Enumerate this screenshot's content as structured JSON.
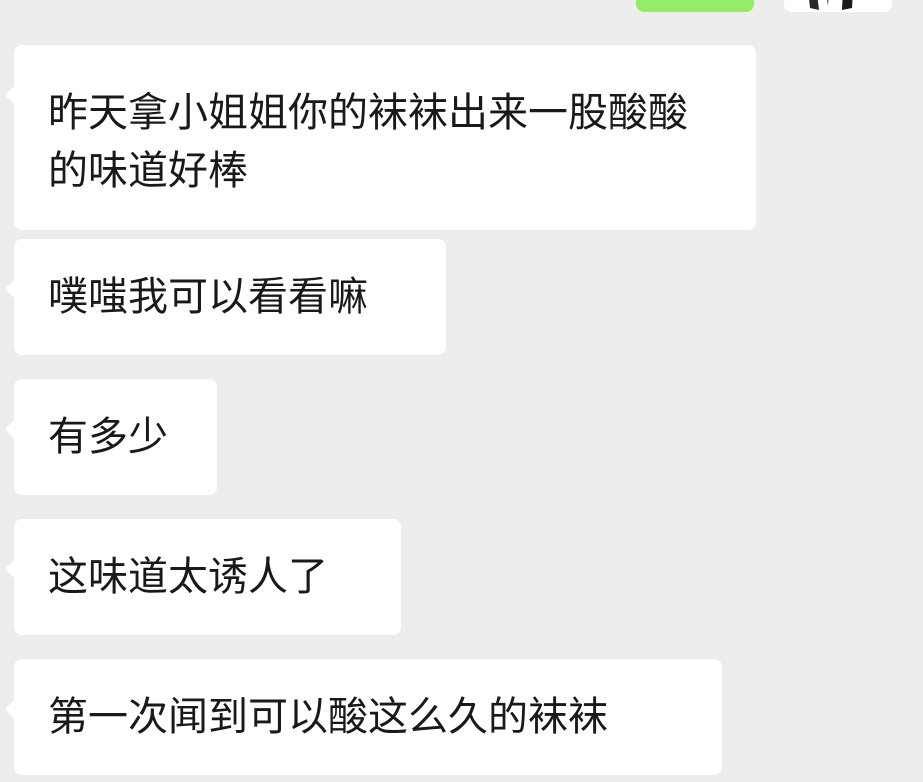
{
  "messages": [
    {
      "text": "昨天拿小姐姐你的袜袜出来一股酸酸的味道好棒"
    },
    {
      "text": "噗嗤我可以看看嘛"
    },
    {
      "text": "有多少"
    },
    {
      "text": "这味道太诱人了"
    },
    {
      "text": "第一次闻到可以酸这么久的袜袜"
    }
  ],
  "colors": {
    "background": "#ededed",
    "received_bubble": "#ffffff",
    "sent_bubble": "#95ec69",
    "text": "#191919"
  }
}
